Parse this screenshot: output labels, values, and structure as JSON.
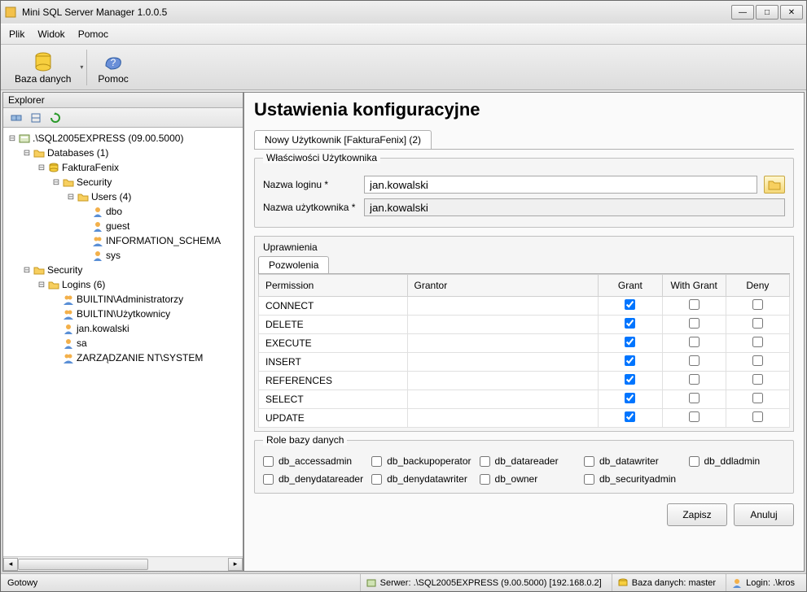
{
  "window": {
    "title": "Mini SQL Server Manager 1.0.0.5"
  },
  "menu": {
    "file": "Plik",
    "view": "Widok",
    "help": "Pomoc"
  },
  "toolbar": {
    "database": "Baza danych",
    "help": "Pomoc"
  },
  "sidebar": {
    "title": "Explorer",
    "nodes": [
      {
        "level": 0,
        "expander": "⊟",
        "icon": "server",
        "label": ".\\SQL2005EXPRESS (09.00.5000)"
      },
      {
        "level": 1,
        "expander": "⊟",
        "icon": "folder",
        "label": "Databases (1)"
      },
      {
        "level": 2,
        "expander": "⊟",
        "icon": "db",
        "label": "FakturaFenix"
      },
      {
        "level": 3,
        "expander": "⊟",
        "icon": "folder",
        "label": "Security"
      },
      {
        "level": 4,
        "expander": "⊟",
        "icon": "folder",
        "label": "Users (4)"
      },
      {
        "level": 5,
        "expander": "",
        "icon": "user",
        "label": "dbo"
      },
      {
        "level": 5,
        "expander": "",
        "icon": "user",
        "label": "guest"
      },
      {
        "level": 5,
        "expander": "",
        "icon": "users",
        "label": "INFORMATION_SCHEMA"
      },
      {
        "level": 5,
        "expander": "",
        "icon": "user",
        "label": "sys"
      },
      {
        "level": 1,
        "expander": "⊟",
        "icon": "folder",
        "label": "Security"
      },
      {
        "level": 2,
        "expander": "⊟",
        "icon": "folder",
        "label": "Logins (6)"
      },
      {
        "level": 3,
        "expander": "",
        "icon": "users",
        "label": "BUILTIN\\Administratorzy"
      },
      {
        "level": 3,
        "expander": "",
        "icon": "users",
        "label": "BUILTIN\\Użytkownicy"
      },
      {
        "level": 3,
        "expander": "",
        "icon": "user",
        "label": "jan.kowalski"
      },
      {
        "level": 3,
        "expander": "",
        "icon": "user",
        "label": "sa"
      },
      {
        "level": 3,
        "expander": "",
        "icon": "users",
        "label": "ZARZĄDZANIE NT\\SYSTEM"
      }
    ]
  },
  "main": {
    "heading": "Ustawienia konfiguracyjne",
    "tab": "Nowy Użytkownik [FakturaFenix] (2)",
    "user_props_title": "Właściwości Użytkownika",
    "login_label": "Nazwa loginu *",
    "login_value": "jan.kowalski",
    "username_label": "Nazwa użytkownika *",
    "username_value": "jan.kowalski",
    "perms_title": "Uprawnienia",
    "perms_inner_tab": "Pozwolenia",
    "columns": {
      "permission": "Permission",
      "grantor": "Grantor",
      "grant": "Grant",
      "withgrant": "With Grant",
      "deny": "Deny"
    },
    "perm_rows": [
      {
        "name": "CONNECT",
        "grantor": "",
        "grant": true,
        "withgrant": false,
        "deny": false
      },
      {
        "name": "DELETE",
        "grantor": "",
        "grant": true,
        "withgrant": false,
        "deny": false
      },
      {
        "name": "EXECUTE",
        "grantor": "",
        "grant": true,
        "withgrant": false,
        "deny": false
      },
      {
        "name": "INSERT",
        "grantor": "",
        "grant": true,
        "withgrant": false,
        "deny": false
      },
      {
        "name": "REFERENCES",
        "grantor": "",
        "grant": true,
        "withgrant": false,
        "deny": false
      },
      {
        "name": "SELECT",
        "grantor": "",
        "grant": true,
        "withgrant": false,
        "deny": false
      },
      {
        "name": "UPDATE",
        "grantor": "",
        "grant": true,
        "withgrant": false,
        "deny": false
      }
    ],
    "roles_title": "Role bazy danych",
    "roles": [
      "db_accessadmin",
      "db_backupoperator",
      "db_datareader",
      "db_datawriter",
      "db_ddladmin",
      "db_denydatareader",
      "db_denydatawriter",
      "db_owner",
      "db_securityadmin"
    ],
    "save": "Zapisz",
    "cancel": "Anuluj"
  },
  "status": {
    "ready": "Gotowy",
    "server": "Serwer: .\\SQL2005EXPRESS (9.00.5000) [192.168.0.2]",
    "db": "Baza danych: master",
    "login": "Login: .\\kros"
  },
  "icons": {
    "server": "🗄",
    "folder": "📁",
    "db": "🟡",
    "user": "👤",
    "users": "👥"
  }
}
